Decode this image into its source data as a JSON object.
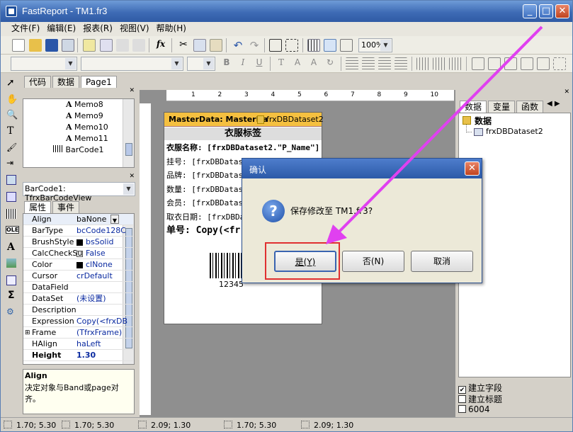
{
  "window": {
    "title": "FastReport - TM1.fr3",
    "min": "_",
    "max": "□",
    "close": "✕"
  },
  "menu": [
    "文件(F)",
    "编辑(E)",
    "报表(R)",
    "视图(V)",
    "帮助(H)"
  ],
  "zoom": "100%",
  "doc_tabs": [
    "代码",
    "数据",
    "Page1"
  ],
  "tree": [
    "Memo8",
    "Memo9",
    "Memo10",
    "Memo11",
    "BarCode1"
  ],
  "object_selector": "BarCode1: TfrxBarCodeView",
  "inspector_tabs": [
    "属性",
    "事件"
  ],
  "properties": [
    {
      "k": "Align",
      "v": "baNone"
    },
    {
      "k": "BarType",
      "v": "bcCode128C"
    },
    {
      "k": "BrushStyle",
      "v": "bsSolid"
    },
    {
      "k": "CalcCheckSu",
      "v": "False"
    },
    {
      "k": "Color",
      "v": "clNone"
    },
    {
      "k": "Cursor",
      "v": "crDefault"
    },
    {
      "k": "DataField",
      "v": ""
    },
    {
      "k": "DataSet",
      "v": "(未设置)"
    },
    {
      "k": "Description",
      "v": ""
    },
    {
      "k": "Expression",
      "v": "Copy(<frxDB"
    },
    {
      "k": "Frame",
      "v": "(TfrxFrame)"
    },
    {
      "k": "HAlign",
      "v": "haLeft"
    },
    {
      "k": "Height",
      "v": "1.30"
    }
  ],
  "help": {
    "title": "Align",
    "text": "决定对象与Band或page对齐。"
  },
  "ruler_h": [
    "1",
    "2",
    "3",
    "4",
    "5",
    "6",
    "7",
    "8",
    "9",
    "10"
  ],
  "report": {
    "band": "MasterData: MasterDa",
    "dataset": "frxDBDataset2",
    "heading": "衣服标签",
    "lines": [
      "衣服名称: [frxDBDataset2.\"P_Name\"]",
      "挂号: [frxDBDatas",
      "品牌: [frxDBDatas",
      "数量: [frxDBDatas",
      "会员: [frxDBDatas",
      "取衣日期: [frxDBDa",
      "单号: Copy(<fr"
    ],
    "barcode_text": "12345"
  },
  "right_tabs": [
    "数据",
    "变量",
    "函数"
  ],
  "data_tree": {
    "root": "数据",
    "child": "frxDBDataset2"
  },
  "options": [
    {
      "label": "建立字段",
      "checked": true
    },
    {
      "label": "建立标题",
      "checked": false
    },
    {
      "label": "6004",
      "checked": false
    }
  ],
  "dialog": {
    "title": "确认",
    "message": "保存修改至  TM1.fr3?",
    "yes": "是(Y)",
    "no": "否(N)",
    "cancel": "取消",
    "close": "✕"
  },
  "status": [
    "1.70; 5.30",
    "1.70; 5.30",
    "2.09; 1.30",
    "1.70; 5.30",
    "2.09; 1.30"
  ],
  "colors": {
    "title": "#3e6bb5",
    "highlight": "#e03030",
    "arrow": "#e040f0",
    "band": "#f5c040"
  }
}
